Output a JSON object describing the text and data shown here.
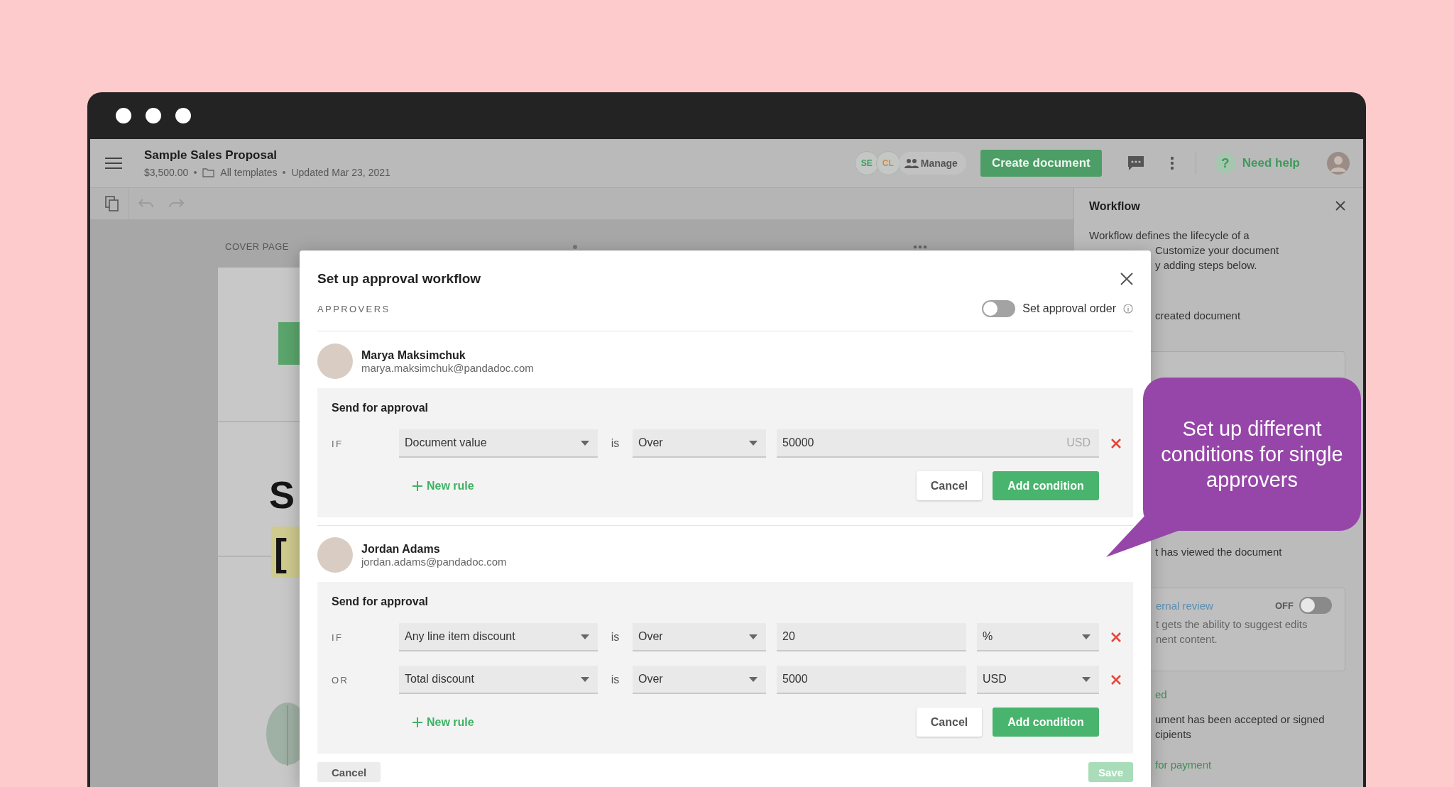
{
  "header": {
    "title": "Sample Sales Proposal",
    "amount": "$3,500.00",
    "folder": "All templates",
    "updated": "Updated Mar 23, 2021",
    "collaborators": [
      {
        "initials": "SE",
        "color": "#3f9a63"
      },
      {
        "initials": "CL",
        "color": "#d9883a"
      }
    ],
    "manage": "Manage",
    "create_button": "Create document",
    "help_icon": "?",
    "help": "Need help"
  },
  "toolbar": {
    "undo_disabled": true,
    "redo_disabled": true
  },
  "document": {
    "section": "COVER PAGE",
    "heading": "S",
    "placeholder": "["
  },
  "workflow_panel": {
    "title": "Workflow",
    "intro": [
      "Workflow defines the lifecycle of a",
      "Customize your document",
      "y adding steps below."
    ],
    "blocks": [
      {
        "kind": "note",
        "lines": [
          "created document"
        ]
      },
      {
        "kind": "card"
      },
      {
        "kind": "note",
        "lines": [
          "t has viewed the document"
        ]
      },
      {
        "kind": "card",
        "title": "ernal review",
        "status": "OFF",
        "on": false,
        "lines": [
          "t gets the ability to suggest edits",
          "nent content."
        ]
      },
      {
        "kind": "heading",
        "text": "ed"
      },
      {
        "kind": "note",
        "lines": [
          "ument has been accepted or signed",
          "cipients"
        ]
      },
      {
        "kind": "heading",
        "text": "for payment"
      }
    ]
  },
  "modal": {
    "title": "Set up approval workflow",
    "section": "APPROVERS",
    "approval_order": {
      "label": "Set approval order",
      "on": false
    },
    "approvers": [
      {
        "name": "Marya Maksimchuk",
        "email": "marya.maksimchuk@pandadoc.com",
        "heading": "Send for approval",
        "rules": [
          {
            "connector": "IF",
            "field": "Document value",
            "is": "is",
            "operator": "Over",
            "value": "50000",
            "kind": "suffix",
            "unit": "USD"
          }
        ],
        "new_rule": "New rule",
        "cancel": "Cancel",
        "add": "Add condition"
      },
      {
        "name": "Jordan Adams",
        "email": "jordan.adams@pandadoc.com",
        "heading": "Send for approval",
        "rules": [
          {
            "connector": "IF",
            "field": "Any line item discount",
            "is": "is",
            "operator": "Over",
            "value": "20",
            "kind": "select",
            "unit": "%"
          },
          {
            "connector": "OR",
            "field": "Total discount",
            "is": "is",
            "operator": "Over",
            "value": "5000",
            "kind": "select",
            "unit": "USD"
          }
        ],
        "new_rule": "New rule",
        "cancel": "Cancel",
        "add": "Add condition"
      }
    ],
    "footer": {
      "cancel": "Cancel",
      "save": "Save",
      "disabled": true
    }
  },
  "callout": {
    "lines": [
      "Set up different",
      "conditions for single",
      "approvers"
    ]
  }
}
